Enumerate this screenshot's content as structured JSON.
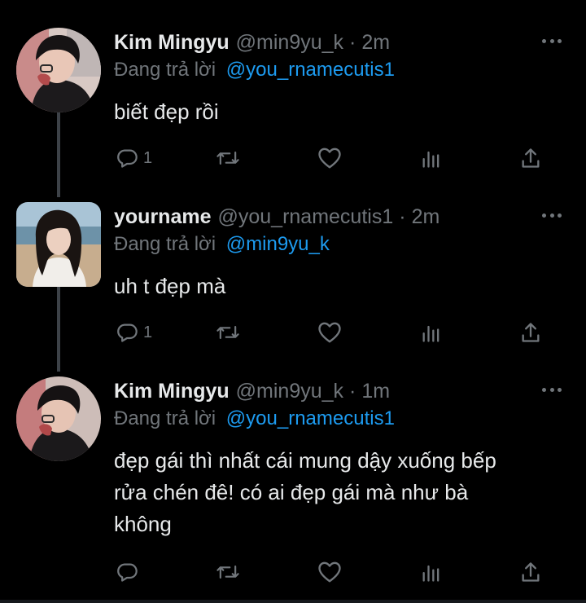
{
  "colors": {
    "background": "#000000",
    "text_primary": "#e7e9ea",
    "text_secondary": "#71767b",
    "mention": "#1d9bf0",
    "thread_line": "#3d4248"
  },
  "icons": {
    "reply": "speech-bubble-icon",
    "retweet": "retweet-arrows-icon",
    "like": "heart-icon",
    "views": "bar-chart-icon",
    "share": "share-upload-icon",
    "more": "three-dots-icon"
  },
  "reply_prefix": "Đang trả lời",
  "tweets": [
    {
      "name": "Kim Mingyu",
      "handle": "@min9yu_k",
      "time": "2m",
      "replying_to": "@you_rnamecutis1",
      "text": "biết đẹp rồi",
      "reply_count": "1"
    },
    {
      "name": "yourname",
      "handle": "@you_rnamecutis1",
      "time": "2m",
      "replying_to": "@min9yu_k",
      "text": "uh t đẹp mà",
      "reply_count": "1"
    },
    {
      "name": "Kim Mingyu",
      "handle": "@min9yu_k",
      "time": "1m",
      "replying_to": "@you_rnamecutis1",
      "text_lines": [
        "đẹp gái thì nhất cái mung dậy xuống bếp",
        "rửa chén đê! có ai đẹp gái mà như bà",
        "không"
      ],
      "reply_count": ""
    }
  ]
}
